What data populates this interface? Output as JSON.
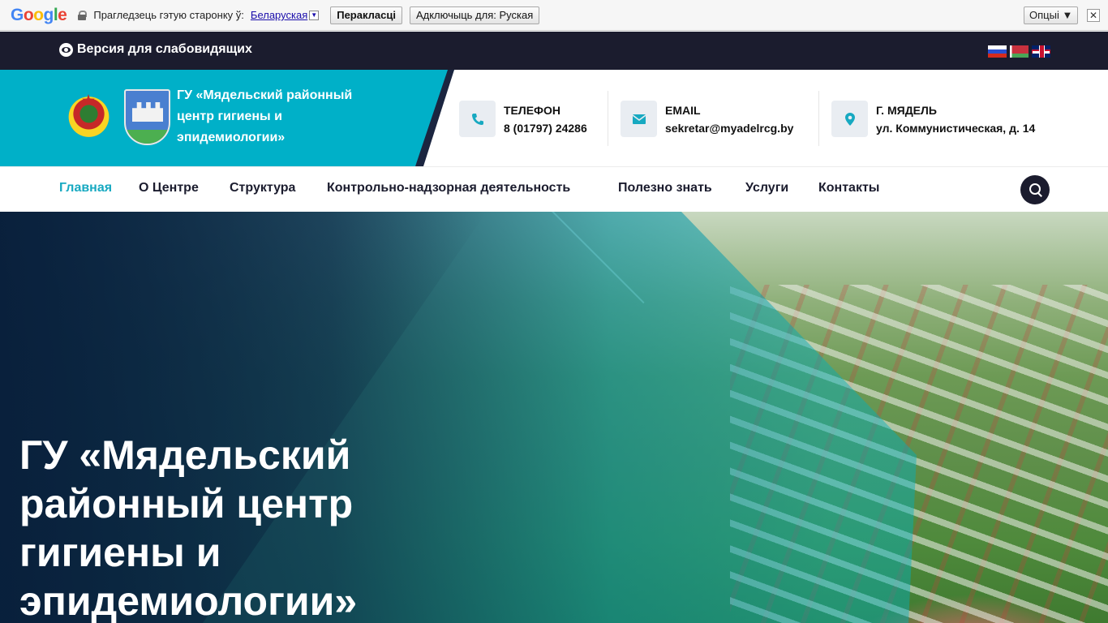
{
  "translate_bar": {
    "logo": [
      "G",
      "o",
      "o",
      "g",
      "l",
      "e"
    ],
    "prompt": "Прагледзець гэтую старонку ў:",
    "language": "Беларуская",
    "dropdown_glyph": "▼",
    "translate_button": "Перакласці",
    "disable_button": "Адключыць для: Руская",
    "options_button": "Опцыі ▼",
    "close": "✕"
  },
  "topbar": {
    "vision_label": "Версия для слабовидящих",
    "flags": [
      "ru",
      "by",
      "en"
    ]
  },
  "header": {
    "org_name": "ГУ «Мядельский районный центр гигиены и эпидемиологии»",
    "contacts": [
      {
        "icon": "phone-icon",
        "label": "ТЕЛЕФОН",
        "value": "8 (01797) 24286"
      },
      {
        "icon": "envelope-icon",
        "label": "EMAIL",
        "value": "sekretar@myadelrcg.by"
      },
      {
        "icon": "map-marker-icon",
        "label": "Г. МЯДЕЛЬ",
        "value": "ул. Коммунистическая, д. 14"
      }
    ]
  },
  "nav": {
    "items": [
      "Главная",
      "О Центре",
      "Структура",
      "Контрольно-надзорная деятельность",
      "Полезно знать",
      "Услуги",
      "Контакты"
    ],
    "active": "Главная"
  },
  "hero": {
    "title": "ГУ «Мядельский районный центр гигиены и эпидемиологии»"
  },
  "colors": {
    "accent": "#00b0c8",
    "dark": "#1b1c2e",
    "nav_active": "#17a9c1"
  }
}
